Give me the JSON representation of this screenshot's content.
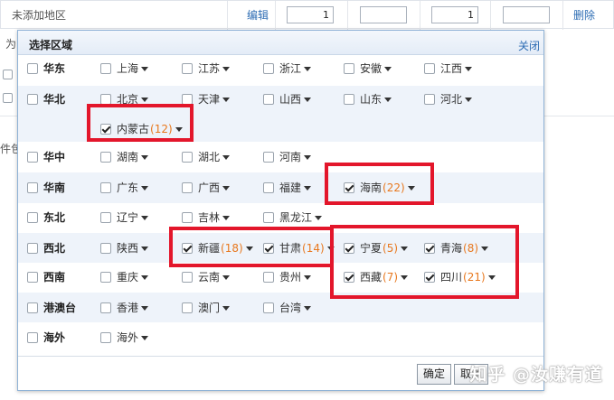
{
  "background": {
    "row_name": "未添加地区",
    "edit_label": "编辑",
    "input1_value": "1",
    "input2_value": "",
    "input3_value": "1",
    "input4_value": "",
    "delete_label": "删除",
    "frag_left": "为",
    "frag_left2": "件包"
  },
  "dialog": {
    "title": "选择区域",
    "close_label": "关闭",
    "regions": [
      {
        "name": "华东",
        "provinces": [
          {
            "name": "上海",
            "count": "",
            "checked": false
          },
          {
            "name": "江苏",
            "count": "",
            "checked": false
          },
          {
            "name": "浙江",
            "count": "",
            "checked": false
          },
          {
            "name": "安徽",
            "count": "",
            "checked": false
          },
          {
            "name": "江西",
            "count": "",
            "checked": false
          }
        ]
      },
      {
        "name": "华北",
        "provinces": [
          {
            "name": "北京",
            "count": "",
            "checked": false
          },
          {
            "name": "天津",
            "count": "",
            "checked": false
          },
          {
            "name": "山西",
            "count": "",
            "checked": false
          },
          {
            "name": "山东",
            "count": "",
            "checked": false
          },
          {
            "name": "河北",
            "count": "",
            "checked": false
          },
          {
            "name": "内蒙古",
            "count": "(12)",
            "checked": true
          }
        ]
      },
      {
        "name": "华中",
        "provinces": [
          {
            "name": "湖南",
            "count": "",
            "checked": false
          },
          {
            "name": "湖北",
            "count": "",
            "checked": false
          },
          {
            "name": "河南",
            "count": "",
            "checked": false
          }
        ]
      },
      {
        "name": "华南",
        "provinces": [
          {
            "name": "广东",
            "count": "",
            "checked": false
          },
          {
            "name": "广西",
            "count": "",
            "checked": false
          },
          {
            "name": "福建",
            "count": "",
            "checked": false
          },
          {
            "name": "海南",
            "count": "(22)",
            "checked": true
          }
        ]
      },
      {
        "name": "东北",
        "provinces": [
          {
            "name": "辽宁",
            "count": "",
            "checked": false
          },
          {
            "name": "吉林",
            "count": "",
            "checked": false
          },
          {
            "name": "黑龙江",
            "count": "",
            "checked": false
          }
        ]
      },
      {
        "name": "西北",
        "provinces": [
          {
            "name": "陕西",
            "count": "",
            "checked": false
          },
          {
            "name": "新疆",
            "count": "(18)",
            "checked": true
          },
          {
            "name": "甘肃",
            "count": "(14)",
            "checked": true
          },
          {
            "name": "宁夏",
            "count": "(5)",
            "checked": true
          },
          {
            "name": "青海",
            "count": "(8)",
            "checked": true
          }
        ]
      },
      {
        "name": "西南",
        "provinces": [
          {
            "name": "重庆",
            "count": "",
            "checked": false
          },
          {
            "name": "云南",
            "count": "",
            "checked": false
          },
          {
            "name": "贵州",
            "count": "",
            "checked": false
          },
          {
            "name": "西藏",
            "count": "(7)",
            "checked": true
          },
          {
            "name": "四川",
            "count": "(21)",
            "checked": true
          }
        ]
      },
      {
        "name": "港澳台",
        "provinces": [
          {
            "name": "香港",
            "count": "",
            "checked": false
          },
          {
            "name": "澳门",
            "count": "",
            "checked": false
          },
          {
            "name": "台湾",
            "count": "",
            "checked": false
          }
        ]
      },
      {
        "name": "海外",
        "provinces": [
          {
            "name": "海外",
            "count": "",
            "checked": false
          }
        ]
      }
    ],
    "confirm_label": "确定",
    "cancel_label": "取消"
  },
  "watermark": "知乎 @汝赚有道",
  "colors": {
    "highlight": "#e3162b",
    "count": "#e8781e",
    "link": "#2e6db4"
  }
}
